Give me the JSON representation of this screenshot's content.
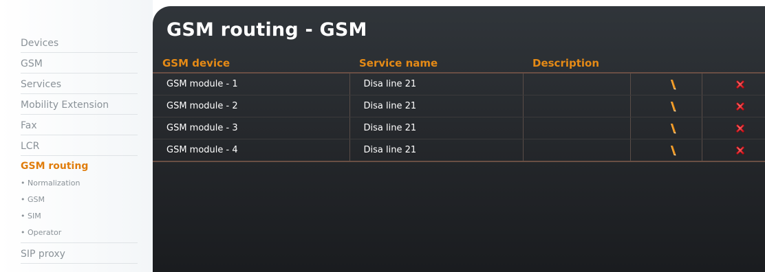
{
  "sidebar": {
    "items_top": [
      {
        "label": "Devices"
      },
      {
        "label": "GSM"
      },
      {
        "label": "Services"
      },
      {
        "label": "Mobility Extension"
      },
      {
        "label": "Fax"
      },
      {
        "label": "LCR"
      }
    ],
    "active": {
      "label": "GSM routing"
    },
    "sub_items": [
      {
        "label": "Normalization"
      },
      {
        "label": "GSM"
      },
      {
        "label": "SIM"
      },
      {
        "label": "Operator"
      }
    ],
    "items_bottom": [
      {
        "label": "SIP proxy"
      }
    ]
  },
  "main": {
    "title": "GSM routing - GSM",
    "columns": {
      "device": "GSM device",
      "service": "Service name",
      "description": "Description"
    },
    "rows": [
      {
        "device": "GSM module - 1",
        "service": "Disa line 21",
        "description": ""
      },
      {
        "device": "GSM module - 2",
        "service": "Disa line 21",
        "description": ""
      },
      {
        "device": "GSM module - 3",
        "service": "Disa line 21",
        "description": ""
      },
      {
        "device": "GSM module - 4",
        "service": "Disa line 21",
        "description": ""
      }
    ]
  },
  "colors": {
    "accent": "#e07d0c",
    "delete": "#e0202a",
    "panel": "#26292d"
  },
  "icons": {
    "edit": "pencil-icon",
    "delete": "delete-icon"
  }
}
